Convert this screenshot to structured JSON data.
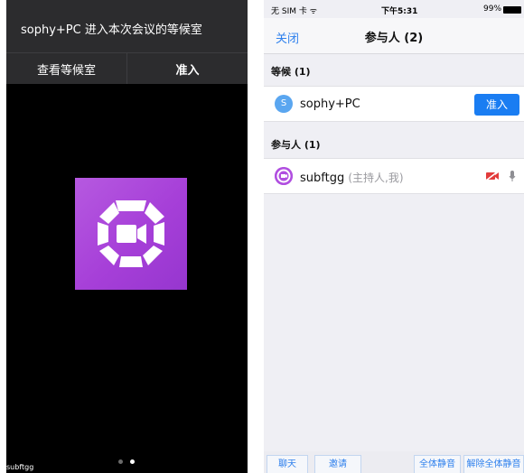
{
  "left": {
    "waiting_message": "sophy+PC 进入本次会议的等候室",
    "view_waiting_room_label": "查看等候室",
    "admit_label": "准入",
    "self_name": "subftgg",
    "page_dots": 2,
    "active_page": 2,
    "tile_color": "#a944d9"
  },
  "right": {
    "status_bar": {
      "carrier": "无 SIM 卡",
      "time": "下午5:31",
      "battery": "99%"
    },
    "nav": {
      "close_label": "关闭",
      "title": "参与人 (2)"
    },
    "waiting_section": {
      "title": "等候 (1)",
      "items": [
        {
          "initial": "S",
          "name": "sophy+PC",
          "action_label": "准入"
        }
      ]
    },
    "participants_section": {
      "title": "参与人 (1)",
      "items": [
        {
          "name": "subftgg",
          "role": "(主持人,我)",
          "video_icon": "video-off-icon",
          "audio_icon": "microphone-icon"
        }
      ]
    },
    "bottom_bar": {
      "chat_label": "聊天",
      "invite_label": "邀请",
      "mute_all_label": "全体静音",
      "unmute_all_label": "解除全体静音"
    },
    "accent_color": "#1a7df2"
  }
}
